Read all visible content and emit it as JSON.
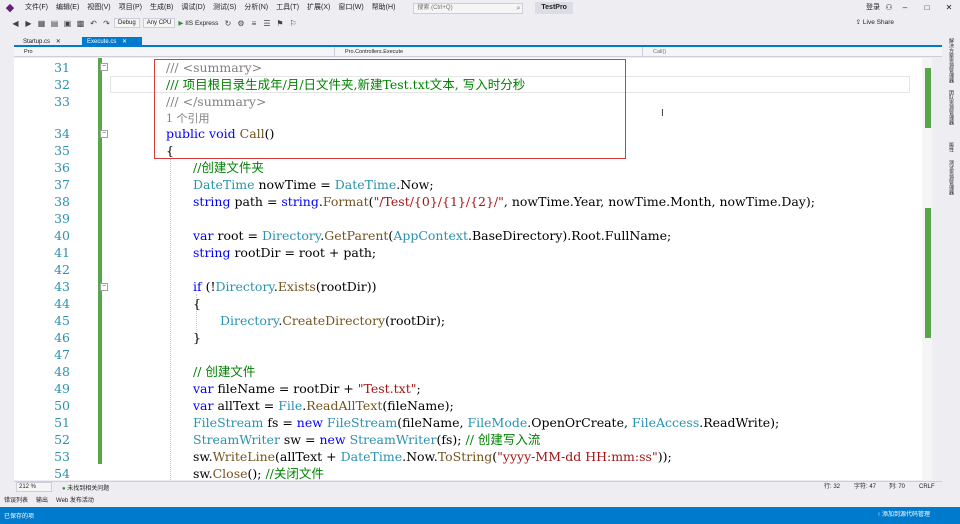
{
  "menu": {
    "items": [
      "文件(F)",
      "编辑(E)",
      "视图(V)",
      "项目(P)",
      "生成(B)",
      "调试(D)",
      "测试(S)",
      "分析(N)",
      "工具(T)",
      "扩展(X)",
      "窗口(W)",
      "帮助(H)"
    ],
    "search_placeholder": "搜索 (Ctrl+Q)",
    "project": "TestPro",
    "login": "登录"
  },
  "toolbar": {
    "config": "Debug",
    "platform": "Any CPU",
    "run": "IIS Express",
    "liveshare": "Live Share"
  },
  "tabs": [
    {
      "label": "Startup.cs"
    },
    {
      "label": "Execute.cs"
    }
  ],
  "navbar": {
    "project": "Pro",
    "class": "Pro.Controllers.Execute",
    "member": "Call()"
  },
  "code": {
    "l31": {
      "num": "31",
      "text": "/// <summary>"
    },
    "l32": {
      "num": "32",
      "text": "/// 项目根目录生成年/月/日文件夹,新建Test.txt文本, 写入时分秒"
    },
    "l33": {
      "num": "33",
      "text": "/// </summary>"
    },
    "refs": "1 个引用",
    "l34": {
      "num": "34",
      "kw1": "public",
      "kw2": "void",
      "name": "Call",
      "rest": "()"
    },
    "l35": {
      "num": "35",
      "text": "{"
    },
    "l36": {
      "num": "36",
      "text": "//创建文件夹"
    },
    "l37": {
      "num": "37",
      "t1": "DateTime",
      "a": " nowTime = ",
      "t2": "DateTime",
      "b": ".Now;"
    },
    "l38": {
      "num": "38",
      "kw": "string",
      "a": " path = ",
      "kw2": "string",
      "b": ".",
      "m": "Format",
      "c": "(",
      "s": "\"/Test/{0}/{1}/{2}/\"",
      "d": ", nowTime.Year, nowTime.Month, nowTime.Day);"
    },
    "l39": {
      "num": "39"
    },
    "l40": {
      "num": "40",
      "kw": "var",
      "a": " root = ",
      "t": "Directory",
      "b": ".",
      "m": "GetParent",
      "c": "(",
      "t2": "AppContext",
      "d": ".BaseDirectory).Root.FullName;"
    },
    "l41": {
      "num": "41",
      "kw": "string",
      "a": " rootDir = root + path;"
    },
    "l42": {
      "num": "42"
    },
    "l43": {
      "num": "43",
      "kw": "if",
      "a": " (!",
      "t": "Directory",
      "b": ".",
      "m": "Exists",
      "c": "(rootDir))"
    },
    "l44": {
      "num": "44",
      "text": "{"
    },
    "l45": {
      "num": "45",
      "t": "Directory",
      "b": ".",
      "m": "CreateDirectory",
      "c": "(rootDir);"
    },
    "l46": {
      "num": "46",
      "text": "}"
    },
    "l47": {
      "num": "47"
    },
    "l48": {
      "num": "48",
      "text": "// 创建文件"
    },
    "l49": {
      "num": "49",
      "kw": "var",
      "a": " fileName = rootDir + ",
      "s": "\"Test.txt\"",
      "b": ";"
    },
    "l50": {
      "num": "50",
      "kw": "var",
      "a": " allText = ",
      "t": "File",
      "b": ".",
      "m": "ReadAllText",
      "c": "(fileName);"
    },
    "l51": {
      "num": "51",
      "t": "FileStream",
      "a": " fs = ",
      "kw": "new",
      "sp": " ",
      "t2": "FileStream",
      "b": "(fileName, ",
      "t3": "FileMode",
      "c": ".OpenOrCreate, ",
      "t4": "FileAccess",
      "d": ".ReadWrite);"
    },
    "l52": {
      "num": "52",
      "t": "StreamWriter",
      "a": " sw = ",
      "kw": "new",
      "sp": " ",
      "t2": "StreamWriter",
      "b": "(fs); ",
      "cm": "// 创建写入流"
    },
    "l53": {
      "num": "53",
      "a": "sw.",
      "m": "WriteLine",
      "b": "(allText + ",
      "t": "DateTime",
      "c": ".Now.",
      "m2": "ToString",
      "d": "(",
      "s": "\"yyyy-MM-dd HH:mm:ss\"",
      "e": "));"
    },
    "l54": {
      "num": "54",
      "a": "sw.",
      "m": "Close",
      "b": "(); ",
      "cm": "//关闭文件"
    }
  },
  "status": {
    "zoom": "212 %",
    "issues": "未找到相关问题",
    "row": "行: 32",
    "col": "字符: 47",
    "col2": "列: 70",
    "crlf": "CRLF"
  },
  "bottom_tabs": [
    "错误列表",
    "输出",
    "Web 发布活动"
  ],
  "statusbar": {
    "left": "已保存的项",
    "right": "添加到源代码管理"
  },
  "side_tabs": [
    "解决方案资源管理器",
    "团队资源管理器",
    "属性",
    "测试资源管理器"
  ],
  "colors": {
    "accent": "#007acc",
    "highlight_box": "#d83b3b",
    "comment": "#008000",
    "keyword": "#0000ff",
    "type": "#2b91af",
    "string": "#a31515"
  }
}
